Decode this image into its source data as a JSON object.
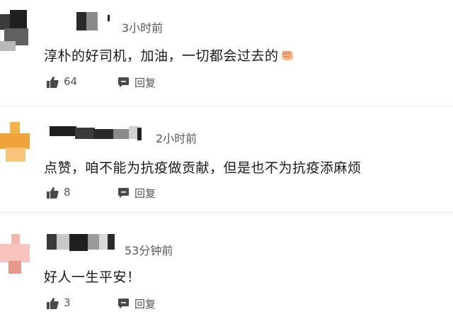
{
  "comments": [
    {
      "time": "3小时前",
      "text": "淳朴的好司机，加油，一切都会过去的",
      "likes": "64",
      "reply_label": "回复",
      "emoji": "fist-emoji"
    },
    {
      "time": "2小时前",
      "text": "点赞，咱不能为抗疫做贡献，但是也不为抗疫添麻烦",
      "likes": "8",
      "reply_label": "回复"
    },
    {
      "time": "53分钟前",
      "text": "好人一生平安！",
      "likes": "3",
      "reply_label": "回复"
    }
  ],
  "colors": {
    "text": "#1a1a1a",
    "meta": "#5a5a5a",
    "divider": "#ececec",
    "icon": "#4a4a4a"
  }
}
